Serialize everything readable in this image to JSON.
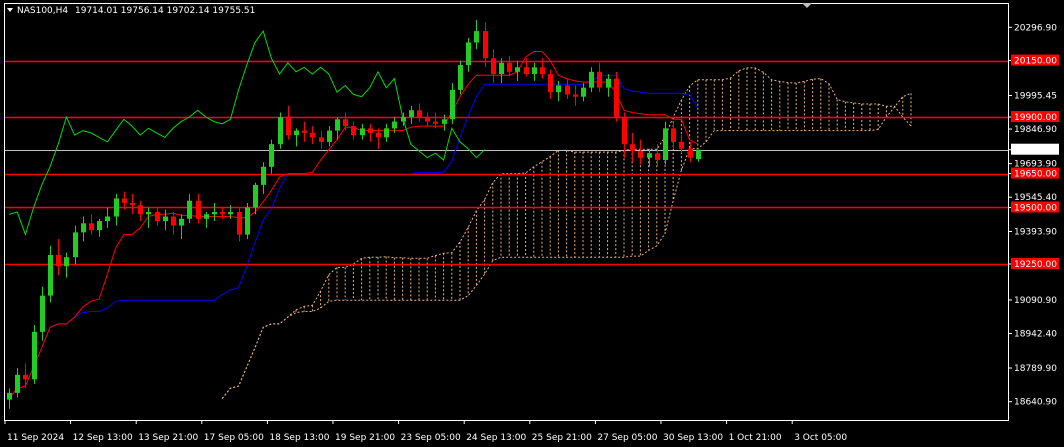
{
  "chart_data": {
    "type": "candlestick",
    "symbol_label": "NAS100,H4",
    "ohlc_readout": "19714.01 19756.14 19702.14 19755.51",
    "current_price": "19755.51",
    "ylim": [
      18560,
      20400
    ],
    "y_ticks": [
      "20296.90",
      "20150.00",
      "19995.45",
      "19900.00",
      "19846.90",
      "19755.51",
      "19693.90",
      "19650.00",
      "19545.40",
      "19500.00",
      "19393.90",
      "19250.00",
      "19090.90",
      "18942.40",
      "18789.90",
      "18640.90"
    ],
    "y_tick_values": [
      20296.9,
      20150.0,
      19995.45,
      19900.0,
      19846.9,
      19755.51,
      19693.9,
      19650.0,
      19545.4,
      19500.0,
      19393.9,
      19250.0,
      19090.9,
      18942.4,
      18789.9,
      18640.9
    ],
    "x_ticks": [
      "11 Sep 2024",
      "12 Sep 13:00",
      "13 Sep 21:00",
      "17 Sep 05:00",
      "18 Sep 13:00",
      "19 Sep 21:00",
      "23 Sep 05:00",
      "24 Sep 13:00",
      "25 Sep 21:00",
      "27 Sep 05:00",
      "30 Sep 13:00",
      "1 Oct 21:00",
      "3 Oct 05:00"
    ],
    "x_tick_index": [
      0,
      8,
      16,
      24,
      32,
      40,
      48,
      56,
      64,
      72,
      80,
      88,
      96
    ],
    "levels": [
      {
        "label": "20150.00",
        "value": 20150.0,
        "color": "#ff0000"
      },
      {
        "label": "19900.00",
        "value": 19900.0,
        "color": "#ff0000"
      },
      {
        "label": "19650.00",
        "value": 19650.0,
        "color": "#ff0000"
      },
      {
        "label": "19500.00",
        "value": 19500.0,
        "color": "#ff0000"
      },
      {
        "label": "19250.00",
        "value": 19250.0,
        "color": "#ff0000"
      }
    ],
    "colors": {
      "bull": "#22cc22",
      "bear": "#ff0000",
      "tenkan": "#ff0000",
      "kijun": "#0000ff",
      "chikou": "#00dd00",
      "cloud": "#e8b07a",
      "level": "#ff0000",
      "price_line": "#c0c0c0",
      "grid": "#ffffff",
      "axis_text": "#ffffff"
    },
    "candles": [
      [
        18650,
        18700,
        18610,
        18680
      ],
      [
        18680,
        18790,
        18660,
        18760
      ],
      [
        18760,
        18810,
        18700,
        18740
      ],
      [
        18740,
        18980,
        18720,
        18950
      ],
      [
        18950,
        19150,
        18910,
        19110
      ],
      [
        19110,
        19330,
        19080,
        19290
      ],
      [
        19290,
        19360,
        19200,
        19240
      ],
      [
        19240,
        19300,
        19190,
        19280
      ],
      [
        19280,
        19420,
        19250,
        19390
      ],
      [
        19390,
        19460,
        19350,
        19430
      ],
      [
        19430,
        19470,
        19380,
        19400
      ],
      [
        19400,
        19450,
        19370,
        19440
      ],
      [
        19440,
        19500,
        19410,
        19460
      ],
      [
        19460,
        19560,
        19420,
        19540
      ],
      [
        19540,
        19570,
        19490,
        19520
      ],
      [
        19520,
        19560,
        19470,
        19510
      ],
      [
        19510,
        19530,
        19440,
        19470
      ],
      [
        19470,
        19500,
        19410,
        19480
      ],
      [
        19480,
        19500,
        19420,
        19440
      ],
      [
        19440,
        19490,
        19400,
        19460
      ],
      [
        19460,
        19480,
        19380,
        19420
      ],
      [
        19420,
        19470,
        19360,
        19450
      ],
      [
        19450,
        19560,
        19430,
        19530
      ],
      [
        19530,
        19560,
        19430,
        19450
      ],
      [
        19450,
        19480,
        19410,
        19470
      ],
      [
        19470,
        19520,
        19440,
        19480
      ],
      [
        19480,
        19500,
        19450,
        19470
      ],
      [
        19470,
        19510,
        19450,
        19480
      ],
      [
        19480,
        19500,
        19350,
        19380
      ],
      [
        19380,
        19520,
        19360,
        19500
      ],
      [
        19500,
        19610,
        19470,
        19600
      ],
      [
        19600,
        19700,
        19560,
        19680
      ],
      [
        19680,
        19800,
        19650,
        19780
      ],
      [
        19780,
        19920,
        19760,
        19900
      ],
      [
        19900,
        19950,
        19800,
        19820
      ],
      [
        19820,
        19850,
        19770,
        19840
      ],
      [
        19840,
        19880,
        19790,
        19830
      ],
      [
        19830,
        19860,
        19780,
        19810
      ],
      [
        19810,
        19840,
        19760,
        19790
      ],
      [
        19790,
        19860,
        19770,
        19840
      ],
      [
        19840,
        19900,
        19800,
        19890
      ],
      [
        19890,
        19920,
        19840,
        19860
      ],
      [
        19860,
        19880,
        19800,
        19820
      ],
      [
        19820,
        19870,
        19800,
        19850
      ],
      [
        19850,
        19870,
        19790,
        19830
      ],
      [
        19830,
        19850,
        19760,
        19810
      ],
      [
        19810,
        19870,
        19790,
        19850
      ],
      [
        19850,
        19900,
        19830,
        19880
      ],
      [
        19880,
        19920,
        19860,
        19900
      ],
      [
        19900,
        19950,
        19870,
        19930
      ],
      [
        19930,
        19960,
        19880,
        19900
      ],
      [
        19900,
        19920,
        19860,
        19880
      ],
      [
        19880,
        19920,
        19850,
        19870
      ],
      [
        19870,
        19910,
        19840,
        19890
      ],
      [
        19890,
        20050,
        19870,
        20020
      ],
      [
        20020,
        20150,
        20000,
        20130
      ],
      [
        20130,
        20250,
        20100,
        20230
      ],
      [
        20230,
        20330,
        20200,
        20280
      ],
      [
        20280,
        20320,
        20120,
        20160
      ],
      [
        20160,
        20200,
        20050,
        20090
      ],
      [
        20090,
        20160,
        20050,
        20140
      ],
      [
        20140,
        20170,
        20080,
        20100
      ],
      [
        20100,
        20150,
        20060,
        20120
      ],
      [
        20120,
        20160,
        20080,
        20090
      ],
      [
        20090,
        20140,
        20060,
        20120
      ],
      [
        20120,
        20160,
        20070,
        20090
      ],
      [
        20090,
        20110,
        19980,
        20010
      ],
      [
        20010,
        20060,
        19970,
        20040
      ],
      [
        20040,
        20070,
        19980,
        20000
      ],
      [
        20000,
        20040,
        19950,
        19990
      ],
      [
        19990,
        20050,
        19970,
        20030
      ],
      [
        20030,
        20120,
        20010,
        20100
      ],
      [
        20100,
        20140,
        20010,
        20030
      ],
      [
        20030,
        20090,
        19990,
        20070
      ],
      [
        20070,
        20100,
        19880,
        19900
      ],
      [
        19900,
        19920,
        19720,
        19780
      ],
      [
        19780,
        19830,
        19700,
        19750
      ],
      [
        19750,
        19800,
        19690,
        19720
      ],
      [
        19720,
        19760,
        19680,
        19740
      ],
      [
        19740,
        19780,
        19680,
        19710
      ],
      [
        19710,
        19880,
        19690,
        19850
      ],
      [
        19850,
        19880,
        19760,
        19790
      ],
      [
        19790,
        19820,
        19740,
        19760
      ],
      [
        19760,
        19790,
        19700,
        19720
      ],
      [
        19714.01,
        19756.14,
        19702.14,
        19755.51
      ]
    ]
  }
}
